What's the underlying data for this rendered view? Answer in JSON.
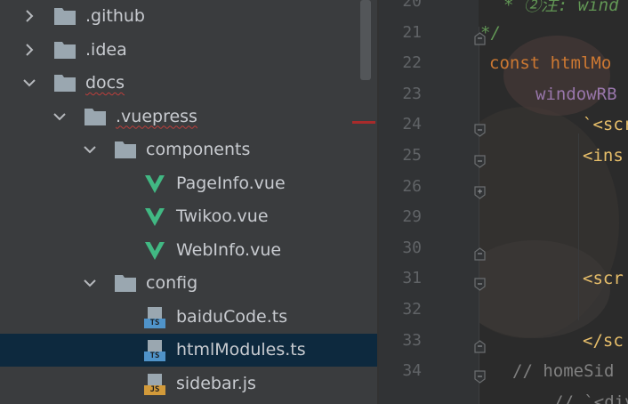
{
  "project_tree": {
    "items": [
      {
        "label": ".github",
        "kind": "folder",
        "expanded": false,
        "depth": 0
      },
      {
        "label": ".idea",
        "kind": "folder",
        "expanded": false,
        "depth": 0
      },
      {
        "label": "docs",
        "kind": "folder",
        "expanded": true,
        "depth": 0,
        "error": true
      },
      {
        "label": ".vuepress",
        "kind": "folder",
        "expanded": true,
        "depth": 1,
        "error": true
      },
      {
        "label": "components",
        "kind": "folder",
        "expanded": true,
        "depth": 2
      },
      {
        "label": "PageInfo.vue",
        "kind": "vue",
        "depth": 3
      },
      {
        "label": "Twikoo.vue",
        "kind": "vue",
        "depth": 3
      },
      {
        "label": "WebInfo.vue",
        "kind": "vue",
        "depth": 3
      },
      {
        "label": "config",
        "kind": "folder",
        "expanded": true,
        "depth": 2
      },
      {
        "label": "baiduCode.ts",
        "kind": "ts",
        "depth": 3
      },
      {
        "label": "htmlModules.ts",
        "kind": "ts",
        "depth": 3,
        "selected": true
      },
      {
        "label": "sidebar.js",
        "kind": "js",
        "depth": 3
      }
    ],
    "badges": {
      "ts": "TS",
      "js": "JS"
    }
  },
  "editor": {
    "line_numbers": [
      "20",
      "21",
      "22",
      "23",
      "24",
      "25",
      "26",
      "29",
      "30",
      "31",
      "32",
      "33",
      "34"
    ],
    "code_lines": [
      {
        "text": "* ②注: wind",
        "color": "#629755",
        "italic": true
      },
      {
        "text": "*/",
        "color": "#629755",
        "italic": true
      },
      {
        "text": "const htmlMo",
        "color": "#cc7832"
      },
      {
        "text": "windowRB",
        "color": "#9876aa"
      },
      {
        "text": "`<scr",
        "color": "#e8bf6a"
      },
      {
        "text": "<ins",
        "color": "#e8bf6a"
      },
      {
        "text": "",
        "color": "#a9b7c6"
      },
      {
        "text": "",
        "color": "#a9b7c6"
      },
      {
        "text": "",
        "color": "#a9b7c6"
      },
      {
        "text": "<scr",
        "color": "#e8bf6a"
      },
      {
        "text": "",
        "color": "#a9b7c6"
      },
      {
        "text": "</sc",
        "color": "#e8bf6a"
      },
      {
        "text": "// homeSid",
        "color": "#808080"
      },
      {
        "text": "// `<div",
        "color": "#808080"
      }
    ]
  },
  "colors": {
    "tree_bg": "#3a3c3e",
    "selection": "#0d293e",
    "vue_green": "#41b883",
    "ts_badge": "#4f93c9",
    "js_badge": "#d29a3a",
    "folder": "#9aa7b0",
    "editor_bg": "#2b2b2b",
    "gutter_bg": "#313335"
  }
}
